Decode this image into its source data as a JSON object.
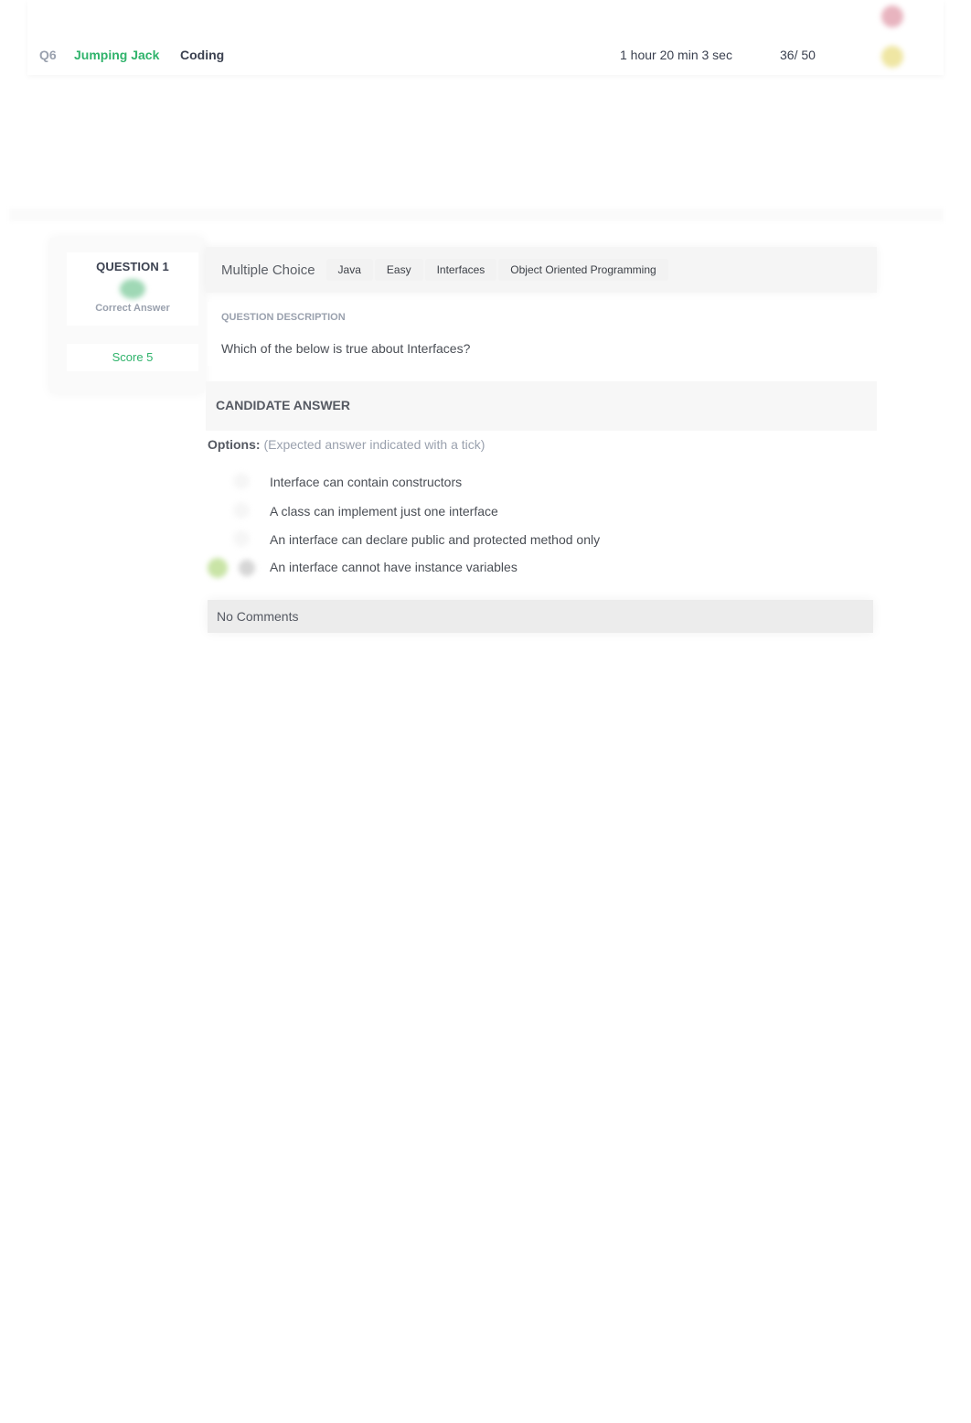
{
  "summary_row": {
    "question_number": "Q6",
    "question_title": "Jumping Jack",
    "question_type": "Coding",
    "time_taken": "1 hour 20 min 3 sec",
    "score": "36/ 50",
    "status_icons": [
      "red-status-icon",
      "yellow-status-icon"
    ]
  },
  "question": {
    "label": "QUESTION 1",
    "status_icon": "correct-icon",
    "status_label": "Correct Answer",
    "score_label": "Score 5",
    "kind": "Multiple Choice",
    "tags": [
      "Java",
      "Easy",
      "Interfaces",
      "Object Oriented Programming"
    ],
    "description_label": "QUESTION DESCRIPTION",
    "description": "Which of the below is true about Interfaces?",
    "candidate_answer_label": "CANDIDATE ANSWER",
    "options_label": "Options:",
    "options_hint": "(Expected answer indicated with a tick)",
    "options": [
      {
        "text": "Interface can contain constructors",
        "expected": false,
        "selected": false
      },
      {
        "text": "A class can implement just one interface",
        "expected": false,
        "selected": false
      },
      {
        "text": "An interface can declare public and protected method only",
        "expected": false,
        "selected": false
      },
      {
        "text": "An interface cannot have instance variables",
        "expected": true,
        "selected": true
      }
    ],
    "comments": "No Comments"
  },
  "colors": {
    "accent_green": "#2fb36b",
    "muted_gray": "#9aa1ae",
    "text_dark": "#3b4150"
  }
}
